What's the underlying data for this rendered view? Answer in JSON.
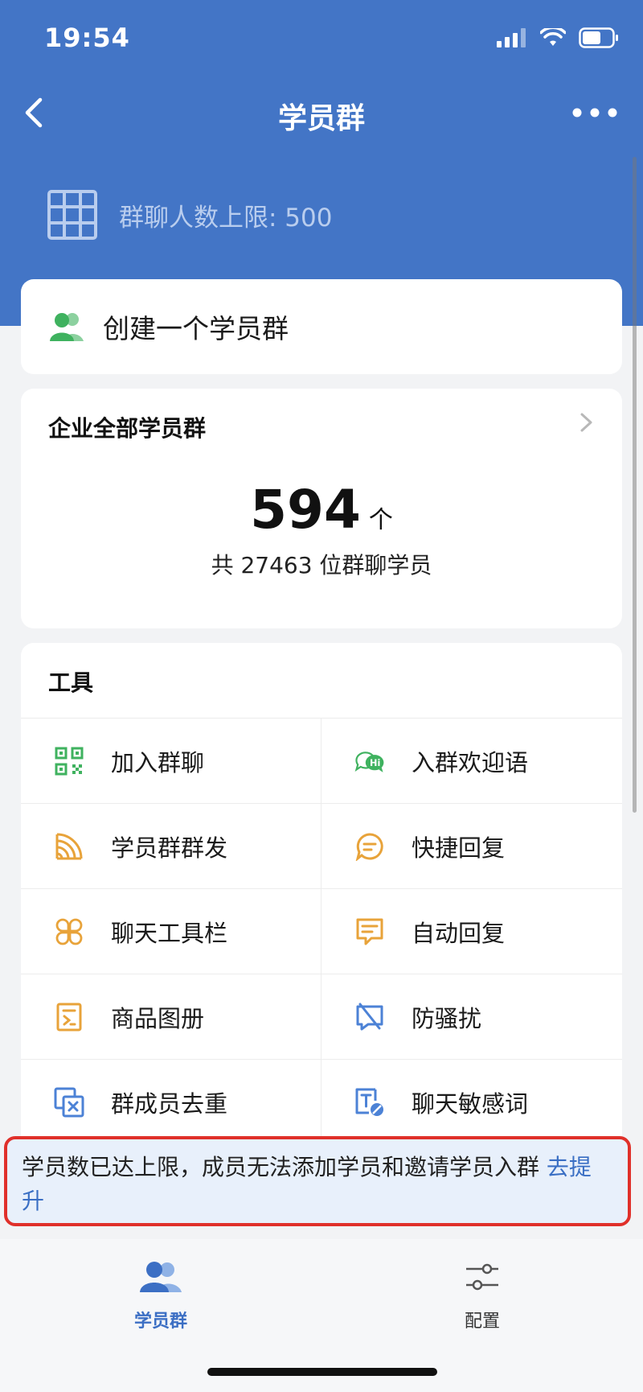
{
  "status_bar": {
    "time": "19:54"
  },
  "nav": {
    "title": "学员群"
  },
  "header": {
    "limit_text": "群聊人数上限: 500"
  },
  "create": {
    "label": "创建一个学员群"
  },
  "all_groups": {
    "title": "企业全部学员群",
    "count": "594",
    "unit": "个",
    "subtitle": "共 27463 位群聊学员"
  },
  "tools": {
    "title": "工具",
    "items": [
      {
        "label": "加入群聊",
        "icon": "qr-code-icon"
      },
      {
        "label": "入群欢迎语",
        "icon": "hi-chat-icon"
      },
      {
        "label": "学员群群发",
        "icon": "broadcast-icon"
      },
      {
        "label": "快捷回复",
        "icon": "quick-reply-icon"
      },
      {
        "label": "聊天工具栏",
        "icon": "toolbar-icon"
      },
      {
        "label": "自动回复",
        "icon": "auto-reply-icon"
      },
      {
        "label": "商品图册",
        "icon": "catalog-icon"
      },
      {
        "label": "防骚扰",
        "icon": "anti-harass-icon"
      },
      {
        "label": "群成员去重",
        "icon": "dedupe-icon"
      },
      {
        "label": "聊天敏感词",
        "icon": "sensitive-word-icon"
      }
    ]
  },
  "alert": {
    "text": "学员数已达上限，成员无法添加学员和邀请学员入群 ",
    "link": "去提升"
  },
  "tab_bar": {
    "tabs": [
      {
        "label": "学员群",
        "active": true
      },
      {
        "label": "配置",
        "active": false
      }
    ]
  },
  "colors": {
    "brand_blue": "#4375c6",
    "green": "#3fb25f",
    "orange": "#e8a33a",
    "blue_icon": "#4c82d6",
    "alert_border": "#e0302a"
  }
}
